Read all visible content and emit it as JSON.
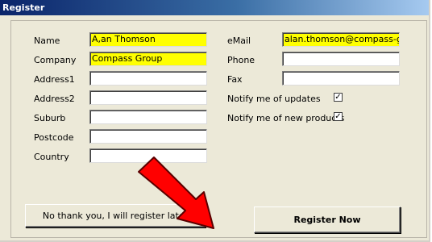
{
  "window": {
    "title": "Register"
  },
  "form": {
    "left_fields": [
      {
        "label": "Name",
        "value": "A,an Thomson"
      },
      {
        "label": "Company",
        "value": "Compass Group"
      },
      {
        "label": "Address1",
        "value": ""
      },
      {
        "label": "Address2",
        "value": ""
      },
      {
        "label": "Suburb",
        "value": ""
      },
      {
        "label": "Postcode",
        "value": ""
      },
      {
        "label": "Country",
        "value": ""
      }
    ],
    "right_fields": [
      {
        "label": "eMail",
        "value": "alan.thomson@compass-group"
      },
      {
        "label": "Phone",
        "value": ""
      },
      {
        "label": "Fax",
        "value": ""
      }
    ],
    "checkboxes": [
      {
        "label": "Notify me of updates",
        "checked": true,
        "mark": "✓"
      },
      {
        "label": "Notify me of new products",
        "checked": true,
        "mark": "✓"
      }
    ]
  },
  "buttons": {
    "decline_label": "No thank you, I will register later",
    "register_label": "Register Now"
  },
  "colors": {
    "filled_field": "#ffff00",
    "arrow": "#ff0000",
    "titlebar": "#0a246a"
  },
  "annotation": {
    "icon": "red-arrow-icon"
  }
}
